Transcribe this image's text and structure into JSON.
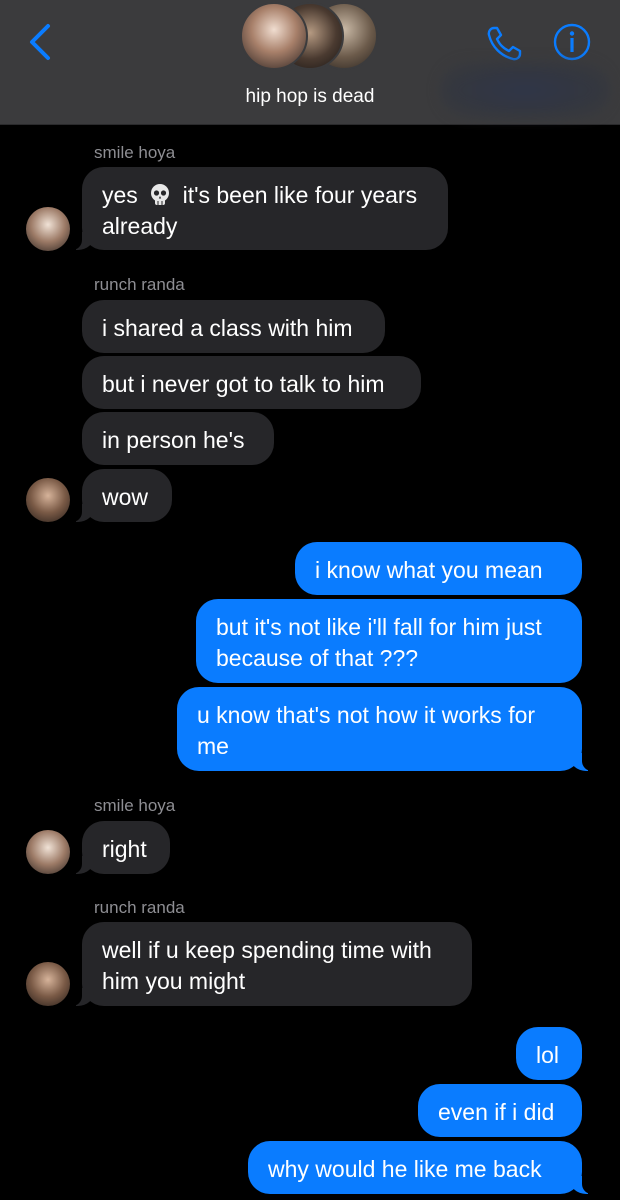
{
  "header": {
    "title": "hip hop is dead",
    "colors": {
      "accent": "#0a7cff",
      "header_bg": "#3b3b3d"
    },
    "icons": {
      "back": "chevron-left-icon",
      "call": "phone-icon",
      "info": "info-icon"
    }
  },
  "senders": {
    "s1": "smile hoya",
    "s2": "runch randa",
    "s3": "smile hoya",
    "s4": "runch randa"
  },
  "messages": {
    "m1a": "yes",
    "m1b": "it's been like four years",
    "m1c": "already",
    "m2": "i shared a class with him",
    "m3": "but i never got to talk to him",
    "m4": "in person he's",
    "m5": "wow",
    "m6": "i know what you mean",
    "m7a": "but it's not like i'll fall for him just",
    "m7b": "because of that ???",
    "m8a": "u know that's not how it works for",
    "m8b": "me",
    "m9": "right",
    "m10a": "well if u keep spending time with",
    "m10b": "him you might",
    "m11": "lol",
    "m12": "even if i did",
    "m13": "why would he like me back"
  },
  "colors": {
    "sent_bubble": "#0a7cff",
    "received_bubble": "#262629",
    "background": "#000000"
  }
}
